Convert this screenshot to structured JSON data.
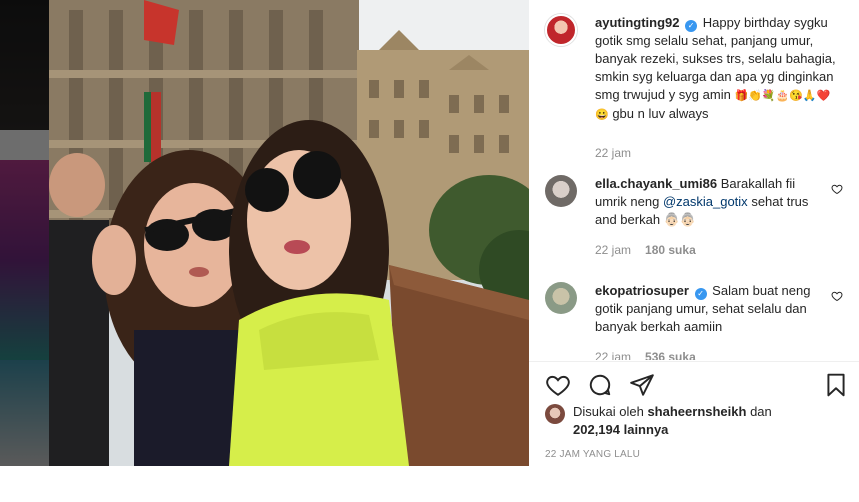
{
  "post": {
    "author": "ayutingting92",
    "caption": "Happy birthday sygku gotik smg selalu sehat, panjang umur, banyak rezeki, sukses trs, selalu bahagia, smkin syg keluarga dan apa yg dinginkan smg trwujud y syg amin",
    "caption_emojis": "🎁👏💐🎂😘🙏❤️😀",
    "caption_tail": "gbu n luv always",
    "caption_time": "22 jam"
  },
  "comments": [
    {
      "username": "ella.chayank_umi86",
      "text_before": "Barakallah fii umrik neng",
      "mention": "@zaskia_gotix",
      "text_after": "sehat trus and berkah 👵🏻👵🏻",
      "time": "22 jam",
      "likes": "180 suka"
    },
    {
      "username": "ekopatriosuper",
      "text": "Salam buat neng gotik panjang umur, sehat selalu dan banyak berkah aamiin",
      "time": "22 jam",
      "likes": "536 suka"
    }
  ],
  "likes": {
    "prefix": "Disukai oleh",
    "user": "shaheernsheikh",
    "conj": "dan",
    "count": "202,194 lainnya"
  },
  "timestamp": "22 JAM YANG LALU",
  "icons": {
    "like": "heart-icon",
    "comment": "comment-bubble-icon",
    "share": "paper-plane-icon",
    "save": "bookmark-icon",
    "verified": "verified-badge-icon"
  },
  "colors": {
    "verified": "#3897f0",
    "mention": "#00376b",
    "secondary_text": "#8e8e8e"
  }
}
